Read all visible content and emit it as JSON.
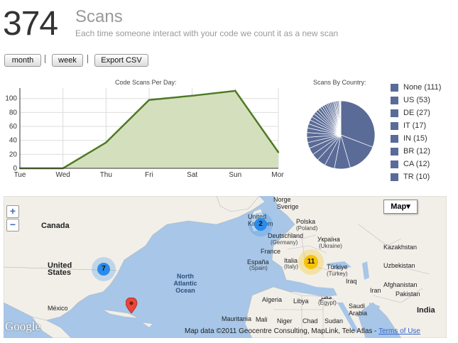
{
  "header": {
    "count": "374",
    "title": "Scans",
    "subtitle": "Each time someone interact with your code we count it as a new scan"
  },
  "toolbar": {
    "month_label": "month",
    "week_label": "week",
    "export_label": "Export CSV",
    "separator": "|"
  },
  "colors": {
    "line": "#4e7a23",
    "area_fill": "#d4e0bd",
    "pie": "#5a6b97",
    "cluster_blue": "#2b8be8",
    "cluster_yellow": "#f5c20a"
  },
  "chart_data": [
    {
      "type": "area",
      "title": "Code Scans Per Day:",
      "categories": [
        "Tue",
        "Wed",
        "Thu",
        "Fri",
        "Sat",
        "Sun",
        "Mon"
      ],
      "values": [
        0,
        0,
        37,
        98,
        104,
        111,
        23
      ],
      "yticks": [
        0,
        20,
        40,
        60,
        80,
        100
      ],
      "ylim": [
        0,
        115
      ],
      "grid": true
    },
    {
      "type": "pie",
      "title": "Scans By Country:",
      "legend_position": "right",
      "labels": [
        "None",
        "US",
        "DE",
        "IT",
        "IN",
        "BR",
        "CA",
        "TR"
      ],
      "values": [
        111,
        53,
        27,
        17,
        15,
        12,
        12,
        10
      ],
      "legend": [
        "None (111)",
        "US (53)",
        "DE (27)",
        "IT (17)",
        "IN (15)",
        "BR (12)",
        "CA (12)",
        "TR (10)"
      ],
      "other_slices": [
        9,
        8,
        8,
        7,
        7,
        6,
        6,
        5,
        5,
        5,
        4,
        4,
        4,
        3,
        3,
        3,
        3,
        2,
        2,
        2,
        2,
        2,
        1,
        1,
        1
      ]
    }
  ],
  "map": {
    "zoom_in": "+",
    "zoom_out": "−",
    "map_type_label": "Map▾",
    "labels": {
      "canada": "Canada",
      "united_states": "United States",
      "mexico": "México",
      "north_atlantic": "North Atlantic Ocean",
      "norge": "Norge",
      "sverige": "Sverige",
      "united_kingdom": "United Kingdom",
      "deutschland": "Deutschland",
      "germany": "(Germany)",
      "polska": "Polska",
      "poland": "(Poland)",
      "ukraine": "Україна",
      "ukraine_en": "(Ukraine)",
      "france": "France",
      "espana": "España",
      "spain": "(Spain)",
      "italia": "Italia",
      "italy": "(Italy)",
      "turkiye": "Türkiye",
      "turkey": "(Turkey)",
      "kazakhstan": "Kazakhstan",
      "uzbekistan": "Uzbekistan",
      "afghanistan": "Afghanistan",
      "pakistan": "Pakistan",
      "iraq": "Iraq",
      "iran": "Iran",
      "algeria": "Algeria",
      "libya": "Libya",
      "misr": "مصر",
      "egypt": "(Egypt)",
      "saudi_arabia": "Saudi Arabia",
      "mauritania": "Mauritania",
      "mali": "Mali",
      "niger": "Niger",
      "chad": "Chad",
      "sudan": "Sudan",
      "india": "India"
    },
    "clusters": {
      "us": "7",
      "uk": "2",
      "italy": "11"
    },
    "google": "Google",
    "attribution": "Map data ©2011 Geocentre Consulting, MapLink, Tele Atlas - ",
    "terms_link": "Terms of Use"
  }
}
